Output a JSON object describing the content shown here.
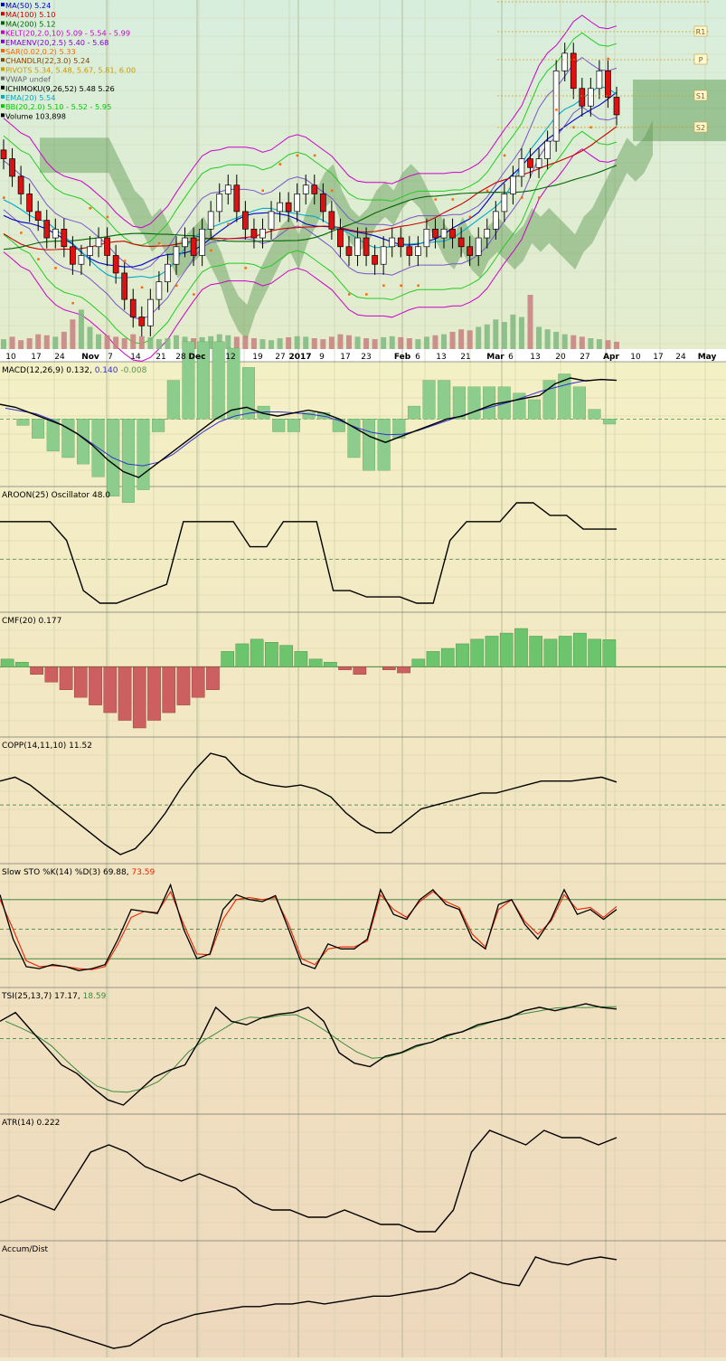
{
  "chart_data": [
    {
      "type": "candlestick",
      "panel": "price",
      "legend": [
        {
          "text": "MA(50) 5.24",
          "color": "#0000cc"
        },
        {
          "text": "MA(100) 5.10",
          "color": "#cc0000"
        },
        {
          "text": "MA(200) 5.12",
          "color": "#006600"
        },
        {
          "text": "KELT(20,2.0,10) 5.09 - 5.54 - 5.99",
          "color": "#cc00cc"
        },
        {
          "text": "EMAENV(20,2.5) 5.40 - 5.68",
          "color": "#8800cc"
        },
        {
          "text": "SAR(0.02,0.2) 5.33",
          "color": "#ff6600"
        },
        {
          "text": "CHANDLR(22,3.0) 5.24",
          "color": "#884400"
        },
        {
          "text": "PIVOTS 5.34, 5.48, 5.67, 5.81, 6.00",
          "color": "#cc9900"
        },
        {
          "text": "VWAP undef",
          "color": "#666666"
        },
        {
          "text": "ICHIMOKU(9,26,52) 5.48 5.26",
          "color": "#000000"
        },
        {
          "text": "EMA(20) 5.54",
          "color": "#00aacc"
        },
        {
          "text": "BB(20,2.0) 5.10 - 5.52 - 5.95",
          "color": "#00cc00"
        },
        {
          "text": "Volume 103,898",
          "color": "#000000"
        }
      ],
      "pivot_labels": [
        "R1",
        "P",
        "S1",
        "S2"
      ],
      "x_labels": [
        "10",
        "17",
        "24",
        "Nov",
        "7",
        "14",
        "21",
        "28",
        "Dec",
        "12",
        "19",
        "27",
        "2017",
        "9",
        "17",
        "23",
        "Feb",
        "6",
        "13",
        "21",
        "Mar",
        "6",
        "13",
        "20",
        "27",
        "Apr",
        "10",
        "17",
        "24",
        "May"
      ],
      "y_range": [
        4.5,
        6.3
      ],
      "close_approx": [
        5.5,
        5.4,
        5.3,
        5.2,
        5.15,
        5.05,
        5.1,
        5.0,
        4.9,
        4.95,
        5.0,
        5.05,
        4.95,
        4.85,
        4.7,
        4.6,
        4.55,
        4.7,
        4.8,
        4.9,
        5.0,
        5.05,
        4.95,
        5.1,
        5.2,
        5.3,
        5.35,
        5.2,
        5.1,
        5.05,
        5.1,
        5.2,
        5.25,
        5.2,
        5.3,
        5.35,
        5.3,
        5.2,
        5.1,
        5.0,
        4.95,
        5.05,
        4.95,
        4.9,
        5.0,
        5.05,
        5.0,
        4.95,
        5.0,
        5.1,
        5.05,
        5.1,
        5.05,
        5.0,
        4.95,
        5.05,
        5.1,
        5.2,
        5.3,
        5.4,
        5.5,
        5.45,
        5.5,
        5.6,
        6.0,
        6.1,
        5.9,
        5.8,
        5.9,
        6.0,
        5.85,
        5.75
      ],
      "volume_approx": [
        20,
        25,
        18,
        22,
        30,
        28,
        25,
        35,
        60,
        80,
        45,
        30,
        28,
        25,
        22,
        30,
        26,
        24,
        20,
        22,
        28,
        25,
        22,
        24,
        26,
        30,
        28,
        25,
        27,
        22,
        20,
        18,
        22,
        24,
        26,
        25,
        22,
        20,
        25,
        30,
        28,
        25,
        22,
        20,
        24,
        26,
        24,
        22,
        20,
        25,
        28,
        30,
        35,
        40,
        38,
        45,
        50,
        60,
        55,
        70,
        65,
        110,
        45,
        40,
        35,
        30,
        28,
        25,
        22,
        20,
        18,
        15
      ]
    },
    {
      "type": "line",
      "panel": "macd",
      "label": "MACD(12,26,9) 0.132,",
      "label2": "0.140",
      "label3": "-0.008",
      "values": [
        0.05,
        0.04,
        0.02,
        0.0,
        -0.02,
        -0.05,
        -0.09,
        -0.14,
        -0.18,
        -0.2,
        -0.16,
        -0.12,
        -0.08,
        -0.04,
        0.0,
        0.03,
        0.04,
        0.02,
        0.01,
        0.02,
        0.03,
        0.02,
        0.0,
        -0.03,
        -0.06,
        -0.08,
        -0.06,
        -0.04,
        -0.02,
        0.0,
        0.01,
        0.03,
        0.05,
        0.06,
        0.07,
        0.08,
        0.12,
        0.14,
        0.13,
        0.135,
        0.132
      ]
    },
    {
      "type": "line",
      "panel": "aroon",
      "label": "AROON(25) Oscillator 48.0",
      "values": [
        60,
        60,
        60,
        60,
        30,
        -50,
        -70,
        -70,
        -60,
        -50,
        -40,
        60,
        60,
        60,
        60,
        20,
        20,
        60,
        60,
        60,
        -50,
        -50,
        -60,
        -60,
        -60,
        -70,
        -70,
        30,
        60,
        60,
        60,
        90,
        90,
        70,
        70,
        48,
        48,
        48
      ]
    },
    {
      "type": "bar",
      "panel": "cmf",
      "label": "CMF(20) 0.177",
      "values": [
        0.05,
        0.03,
        -0.05,
        -0.1,
        -0.15,
        -0.2,
        -0.25,
        -0.3,
        -0.35,
        -0.4,
        -0.35,
        -0.3,
        -0.25,
        -0.2,
        -0.15,
        0.1,
        0.15,
        0.18,
        0.16,
        0.14,
        0.1,
        0.05,
        0.03,
        -0.02,
        -0.05,
        0.0,
        -0.02,
        -0.04,
        0.05,
        0.1,
        0.12,
        0.15,
        0.18,
        0.2,
        0.22,
        0.25,
        0.2,
        0.18,
        0.2,
        0.22,
        0.18,
        0.177
      ]
    },
    {
      "type": "line",
      "panel": "copp",
      "label": "COPP(14,11,10) 11.52",
      "values": [
        12,
        14,
        10,
        4,
        -2,
        -8,
        -14,
        -20,
        -25,
        -22,
        -14,
        -4,
        8,
        18,
        26,
        24,
        16,
        12,
        10,
        9,
        10,
        8,
        4,
        -4,
        -10,
        -14,
        -14,
        -8,
        -2,
        0,
        2,
        4,
        6,
        6,
        8,
        10,
        12,
        12,
        12,
        13,
        14,
        11.5
      ]
    },
    {
      "type": "line",
      "panel": "sto",
      "label": "Slow STO %K(14) %D(3) 69.88,",
      "label2": "73.59",
      "k": [
        85,
        40,
        12,
        10,
        14,
        12,
        8,
        10,
        14,
        40,
        70,
        68,
        66,
        95,
        50,
        20,
        25,
        70,
        85,
        80,
        78,
        84,
        50,
        15,
        10,
        35,
        30,
        30,
        40,
        90,
        65,
        60,
        80,
        90,
        75,
        70,
        40,
        30,
        75,
        80,
        55,
        40,
        60,
        90,
        65,
        70,
        60,
        70
      ],
      "d": [
        80,
        50,
        18,
        12,
        13,
        12,
        10,
        9,
        12,
        35,
        62,
        68,
        67,
        88,
        55,
        25,
        24,
        60,
        80,
        82,
        80,
        82,
        55,
        20,
        14,
        30,
        32,
        32,
        38,
        85,
        70,
        62,
        78,
        88,
        78,
        72,
        45,
        32,
        70,
        80,
        58,
        45,
        58,
        85,
        70,
        72,
        62,
        73
      ]
    },
    {
      "type": "line",
      "panel": "tsi",
      "label": "TSI(25,13,7) 17.17,",
      "label2": "18.59",
      "values": [
        10,
        15,
        5,
        -5,
        -15,
        -20,
        -28,
        -35,
        -38,
        -30,
        -22,
        -18,
        -15,
        0,
        18,
        10,
        8,
        12,
        14,
        15,
        18,
        10,
        -8,
        -14,
        -16,
        -10,
        -8,
        -4,
        -2,
        2,
        4,
        8,
        10,
        12,
        16,
        18,
        16,
        18,
        20,
        18,
        17
      ]
    },
    {
      "type": "line",
      "panel": "atr",
      "label": "ATR(14) 0.222",
      "values": [
        0.13,
        0.14,
        0.13,
        0.12,
        0.16,
        0.2,
        0.21,
        0.2,
        0.18,
        0.17,
        0.16,
        0.17,
        0.16,
        0.15,
        0.13,
        0.12,
        0.12,
        0.11,
        0.11,
        0.12,
        0.11,
        0.1,
        0.1,
        0.09,
        0.09,
        0.12,
        0.2,
        0.23,
        0.22,
        0.21,
        0.23,
        0.22,
        0.22,
        0.21,
        0.22
      ]
    },
    {
      "type": "line",
      "panel": "ad",
      "label": "Accum/Dist",
      "values": [
        0,
        -2,
        -4,
        -5,
        -7,
        -9,
        -11,
        -13,
        -12,
        -8,
        -4,
        -2,
        0,
        1,
        2,
        3,
        3,
        4,
        4,
        5,
        4,
        5,
        6,
        7,
        7,
        8,
        9,
        10,
        12,
        16,
        14,
        12,
        11,
        22,
        20,
        19,
        21,
        22,
        21
      ]
    }
  ]
}
